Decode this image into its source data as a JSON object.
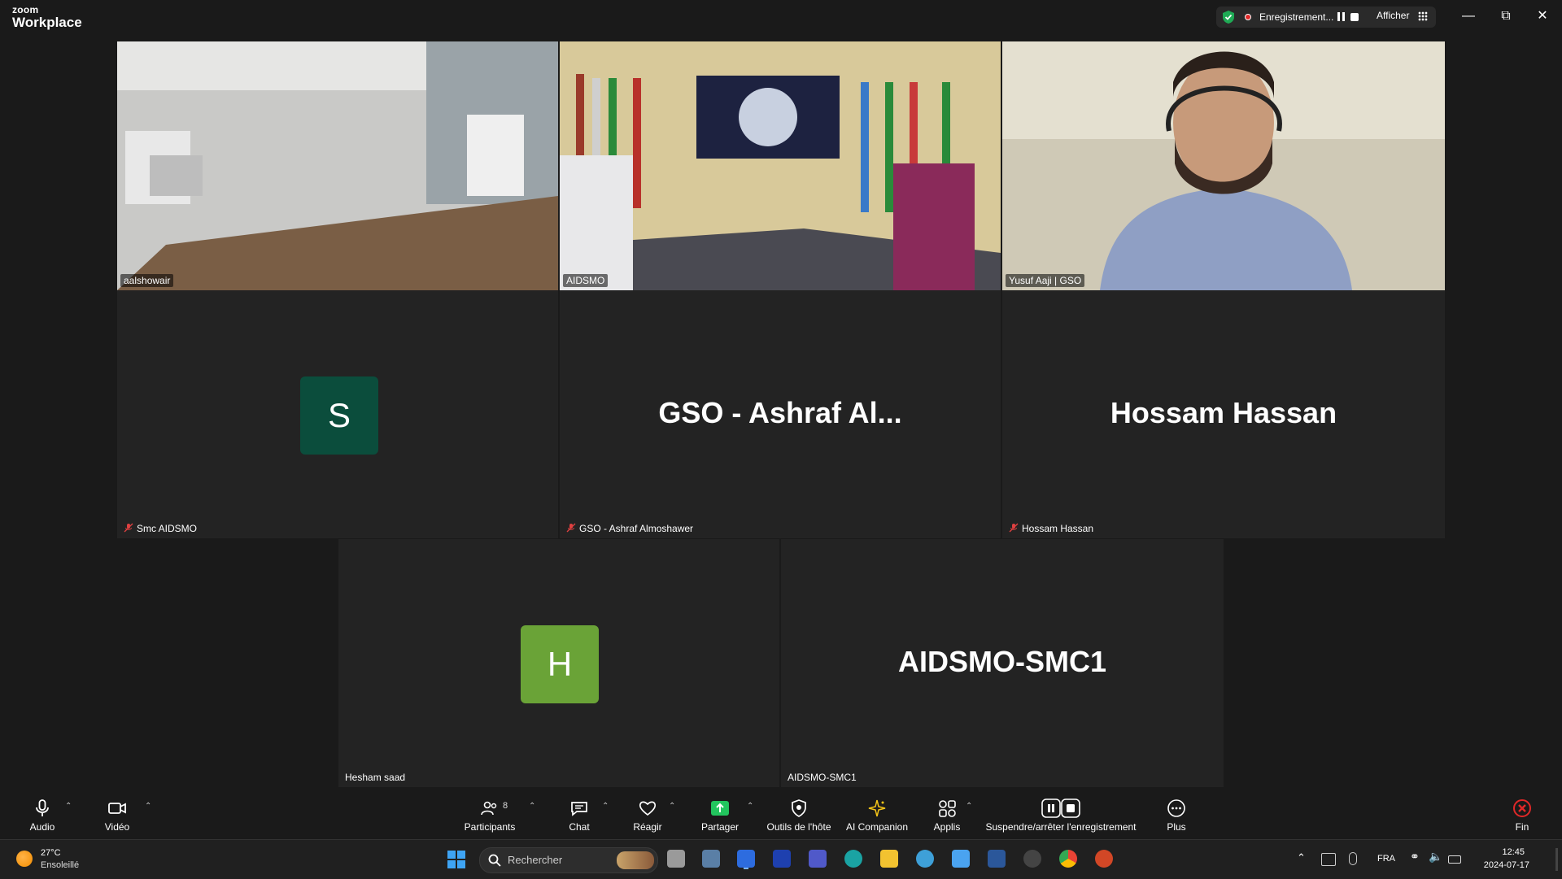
{
  "app": {
    "brand_top": "zoom",
    "brand_bottom": "Workplace",
    "recording_label": "Enregistrement...",
    "view_label": "Afficher",
    "colors": {
      "active_speaker_border": "#2fd483",
      "avatar_s": "#0b4d3c",
      "avatar_h": "#6aa337",
      "record_dot": "#e02828"
    }
  },
  "tiles": {
    "t1": {
      "name": "aalshowair"
    },
    "t2": {
      "name": "AIDSMO",
      "active_speaker": true
    },
    "t3": {
      "name": "Yusuf Aaji | GSO"
    },
    "t4": {
      "name": "Smc AIDSMO",
      "avatar_letter": "S",
      "muted": true
    },
    "t5": {
      "name": "GSO - Ashraf Almoshawer",
      "display": "GSO  -  Ashraf Al...",
      "muted": true
    },
    "t6": {
      "name": "Hossam Hassan",
      "display": "Hossam Hassan",
      "muted": true
    },
    "t7": {
      "name": "Hesham saad",
      "avatar_letter": "H"
    },
    "t8": {
      "name": "AIDSMO-SMC1",
      "display": "AIDSMO-SMC1"
    }
  },
  "toolbar": {
    "audio": "Audio",
    "video": "Vidéo",
    "participants": "Participants",
    "participants_count": "8",
    "chat": "Chat",
    "react": "Réagir",
    "share": "Partager",
    "host_tools": "Outils de l'hôte",
    "ai_companion": "AI Companion",
    "apps": "Applis",
    "recording_control": "Suspendre/arrêter l'enregistrement",
    "more": "Plus",
    "end": "Fin"
  },
  "taskbar": {
    "temperature": "27°C",
    "weather": "Ensoleillé",
    "search_placeholder": "Rechercher",
    "language": "FRA",
    "time": "12:45",
    "date": "2024-07-17"
  }
}
